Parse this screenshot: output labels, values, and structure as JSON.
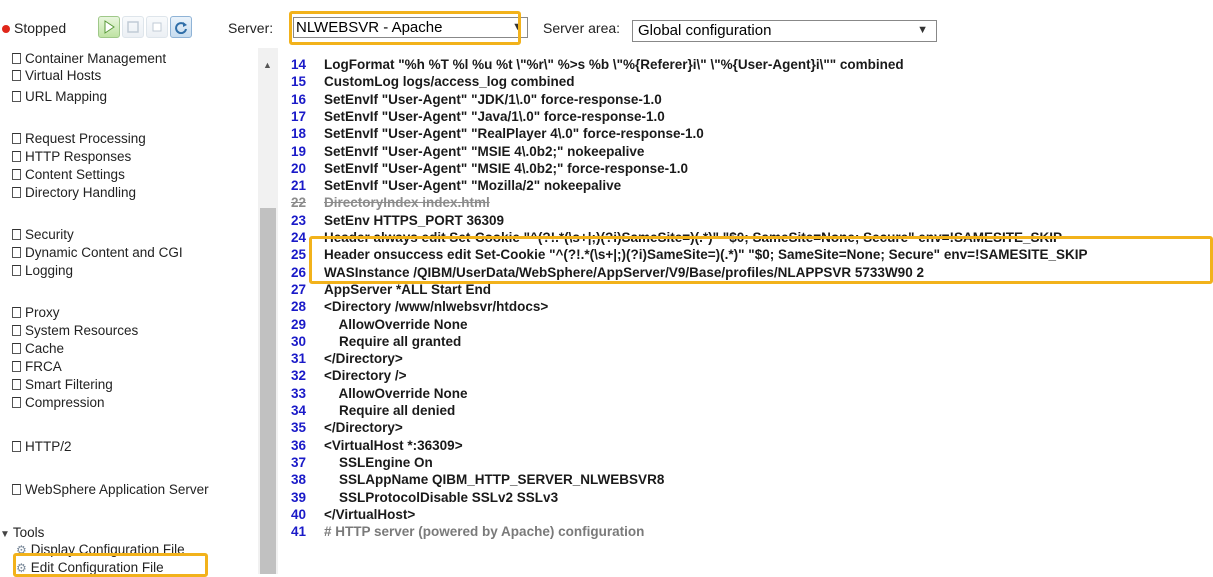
{
  "toolbar": {
    "status": "Stopped",
    "server_label": "Server:",
    "server_value": "NLWEBSVR - Apache",
    "area_label": "Server area:",
    "area_value": "Global configuration",
    "colors": {
      "status_dot": "#e0261a",
      "highlight": "#f2b21b",
      "line_number": "#1a1ac8"
    }
  },
  "sidebar": {
    "items": [
      "Container Management",
      "Virtual Hosts",
      "URL Mapping",
      "Request Processing",
      "HTTP Responses",
      "Content Settings",
      "Directory Handling",
      "Security",
      "Dynamic Content and CGI",
      "Logging",
      "Proxy",
      "System Resources",
      "Cache",
      "FRCA",
      "Smart Filtering",
      "Compression",
      "HTTP/2",
      "WebSphere Application Server"
    ],
    "tools_label": "Tools",
    "tools": [
      "Display Configuration File",
      "Edit Configuration File"
    ]
  },
  "code": {
    "lines": [
      {
        "n": "14",
        "t": "LogFormat \"%h %T %l %u %t \\\"%r\\\" %>s %b \\\"%{Referer}i\\\" \\\"%{User-Agent}i\\\"\" combined",
        "style": "normal"
      },
      {
        "n": "15",
        "t": "CustomLog logs/access_log combined",
        "style": "normal"
      },
      {
        "n": "16",
        "t": "SetEnvIf \"User-Agent\" \"JDK/1\\.0\" force-response-1.0",
        "style": "normal"
      },
      {
        "n": "17",
        "t": "SetEnvIf \"User-Agent\" \"Java/1\\.0\" force-response-1.0",
        "style": "normal"
      },
      {
        "n": "18",
        "t": "SetEnvIf \"User-Agent\" \"RealPlayer 4\\.0\" force-response-1.0",
        "style": "normal"
      },
      {
        "n": "19",
        "t": "SetEnvIf \"User-Agent\" \"MSIE 4\\.0b2;\" nokeepalive",
        "style": "normal"
      },
      {
        "n": "20",
        "t": "SetEnvIf \"User-Agent\" \"MSIE 4\\.0b2;\" force-response-1.0",
        "style": "normal"
      },
      {
        "n": "21",
        "t": "SetEnvIf \"User-Agent\" \"Mozilla/2\" nokeepalive",
        "style": "normal"
      },
      {
        "n": "22",
        "t": "DirectoryIndex index.html",
        "style": "struck"
      },
      {
        "n": "23",
        "t": "SetEnv HTTPS_PORT 36309",
        "style": "normal"
      },
      {
        "n": "24",
        "t": "Header always edit Set-Cookie \"^(?!.*(\\s+|;)(?i)SameSite=)(.*)\" \"$0; SameSite=None; Secure\" env=!SAMESITE_SKIP",
        "style": "normal"
      },
      {
        "n": "25",
        "t": "Header onsuccess edit Set-Cookie \"^(?!.*(\\s+|;)(?i)SameSite=)(.*)\" \"$0; SameSite=None; Secure\" env=!SAMESITE_SKIP",
        "style": "normal"
      },
      {
        "n": "26",
        "t": "WASInstance /QIBM/UserData/WebSphere/AppServer/V9/Base/profiles/NLAPPSVR 5733W90 2",
        "style": "normal"
      },
      {
        "n": "27",
        "t": "AppServer *ALL Start End",
        "style": "normal"
      },
      {
        "n": "28",
        "t": "<Directory /www/nlwebsvr/htdocs>",
        "style": "normal"
      },
      {
        "n": "29",
        "t": "    AllowOverride None",
        "style": "normal"
      },
      {
        "n": "30",
        "t": "    Require all granted",
        "style": "normal"
      },
      {
        "n": "31",
        "t": "</Directory>",
        "style": "normal"
      },
      {
        "n": "32",
        "t": "<Directory />",
        "style": "normal"
      },
      {
        "n": "33",
        "t": "    AllowOverride None",
        "style": "normal"
      },
      {
        "n": "34",
        "t": "    Require all denied",
        "style": "normal"
      },
      {
        "n": "35",
        "t": "</Directory>",
        "style": "normal"
      },
      {
        "n": "36",
        "t": "<VirtualHost *:36309>",
        "style": "normal"
      },
      {
        "n": "37",
        "t": "    SSLEngine On",
        "style": "normal"
      },
      {
        "n": "38",
        "t": "    SSLAppName QIBM_HTTP_SERVER_NLWEBSVR8",
        "style": "normal"
      },
      {
        "n": "39",
        "t": "    SSLProtocolDisable SSLv2 SSLv3",
        "style": "normal"
      },
      {
        "n": "40",
        "t": "</VirtualHost>",
        "style": "normal"
      },
      {
        "n": "41",
        "t": "# HTTP server (powered by Apache) configuration",
        "style": "comment"
      }
    ]
  }
}
